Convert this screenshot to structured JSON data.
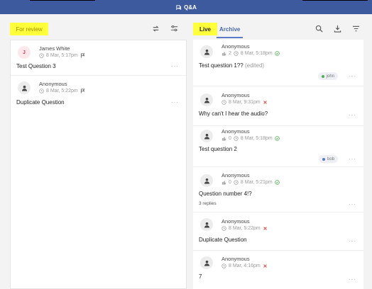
{
  "header": {
    "title": "Q&A",
    "icon": "qa-icon"
  },
  "left": {
    "tab_label": "For review",
    "items": [
      {
        "initial": "J",
        "author": "James White",
        "time": "8 Mar, 5:17pm",
        "text": "Test Question 3"
      },
      {
        "author": "Anonymous",
        "time": "8 Mar, 5:22pm",
        "text": "Duplicate Question"
      }
    ]
  },
  "right": {
    "tab_live": "Live",
    "tab_archive": "Archive",
    "items": [
      {
        "author": "Anonymous",
        "likes": "2",
        "time": "8 Mar, 5:18pm",
        "text": "Test question 1??",
        "edited": "(edited)",
        "tag": "john",
        "tag_color": "#4caf50",
        "status": "answered"
      },
      {
        "author": "Anonymous",
        "time": "8 Mar, 9:31pm",
        "text": "Why can't I hear the audio?",
        "status": "rejected"
      },
      {
        "author": "Anonymous",
        "likes": "0",
        "time": "8 Mar, 5:18pm",
        "text": "Test question 2",
        "tag": "bob",
        "tag_color": "#5a7bc8",
        "status": "answered"
      },
      {
        "author": "Anonymous",
        "likes": "0",
        "time": "8 Mar, 5:21pm",
        "text": "Question number 4!?",
        "replies": "3 replies",
        "status": "answered"
      },
      {
        "author": "Anonymous",
        "time": "8 Mar, 5:22pm",
        "text": "Duplicate Question",
        "status": "rejected"
      },
      {
        "author": "Anonymous",
        "time": "8 Mar, 4:16pm",
        "text": "7",
        "status": "rejected"
      }
    ]
  },
  "more_label": "···"
}
